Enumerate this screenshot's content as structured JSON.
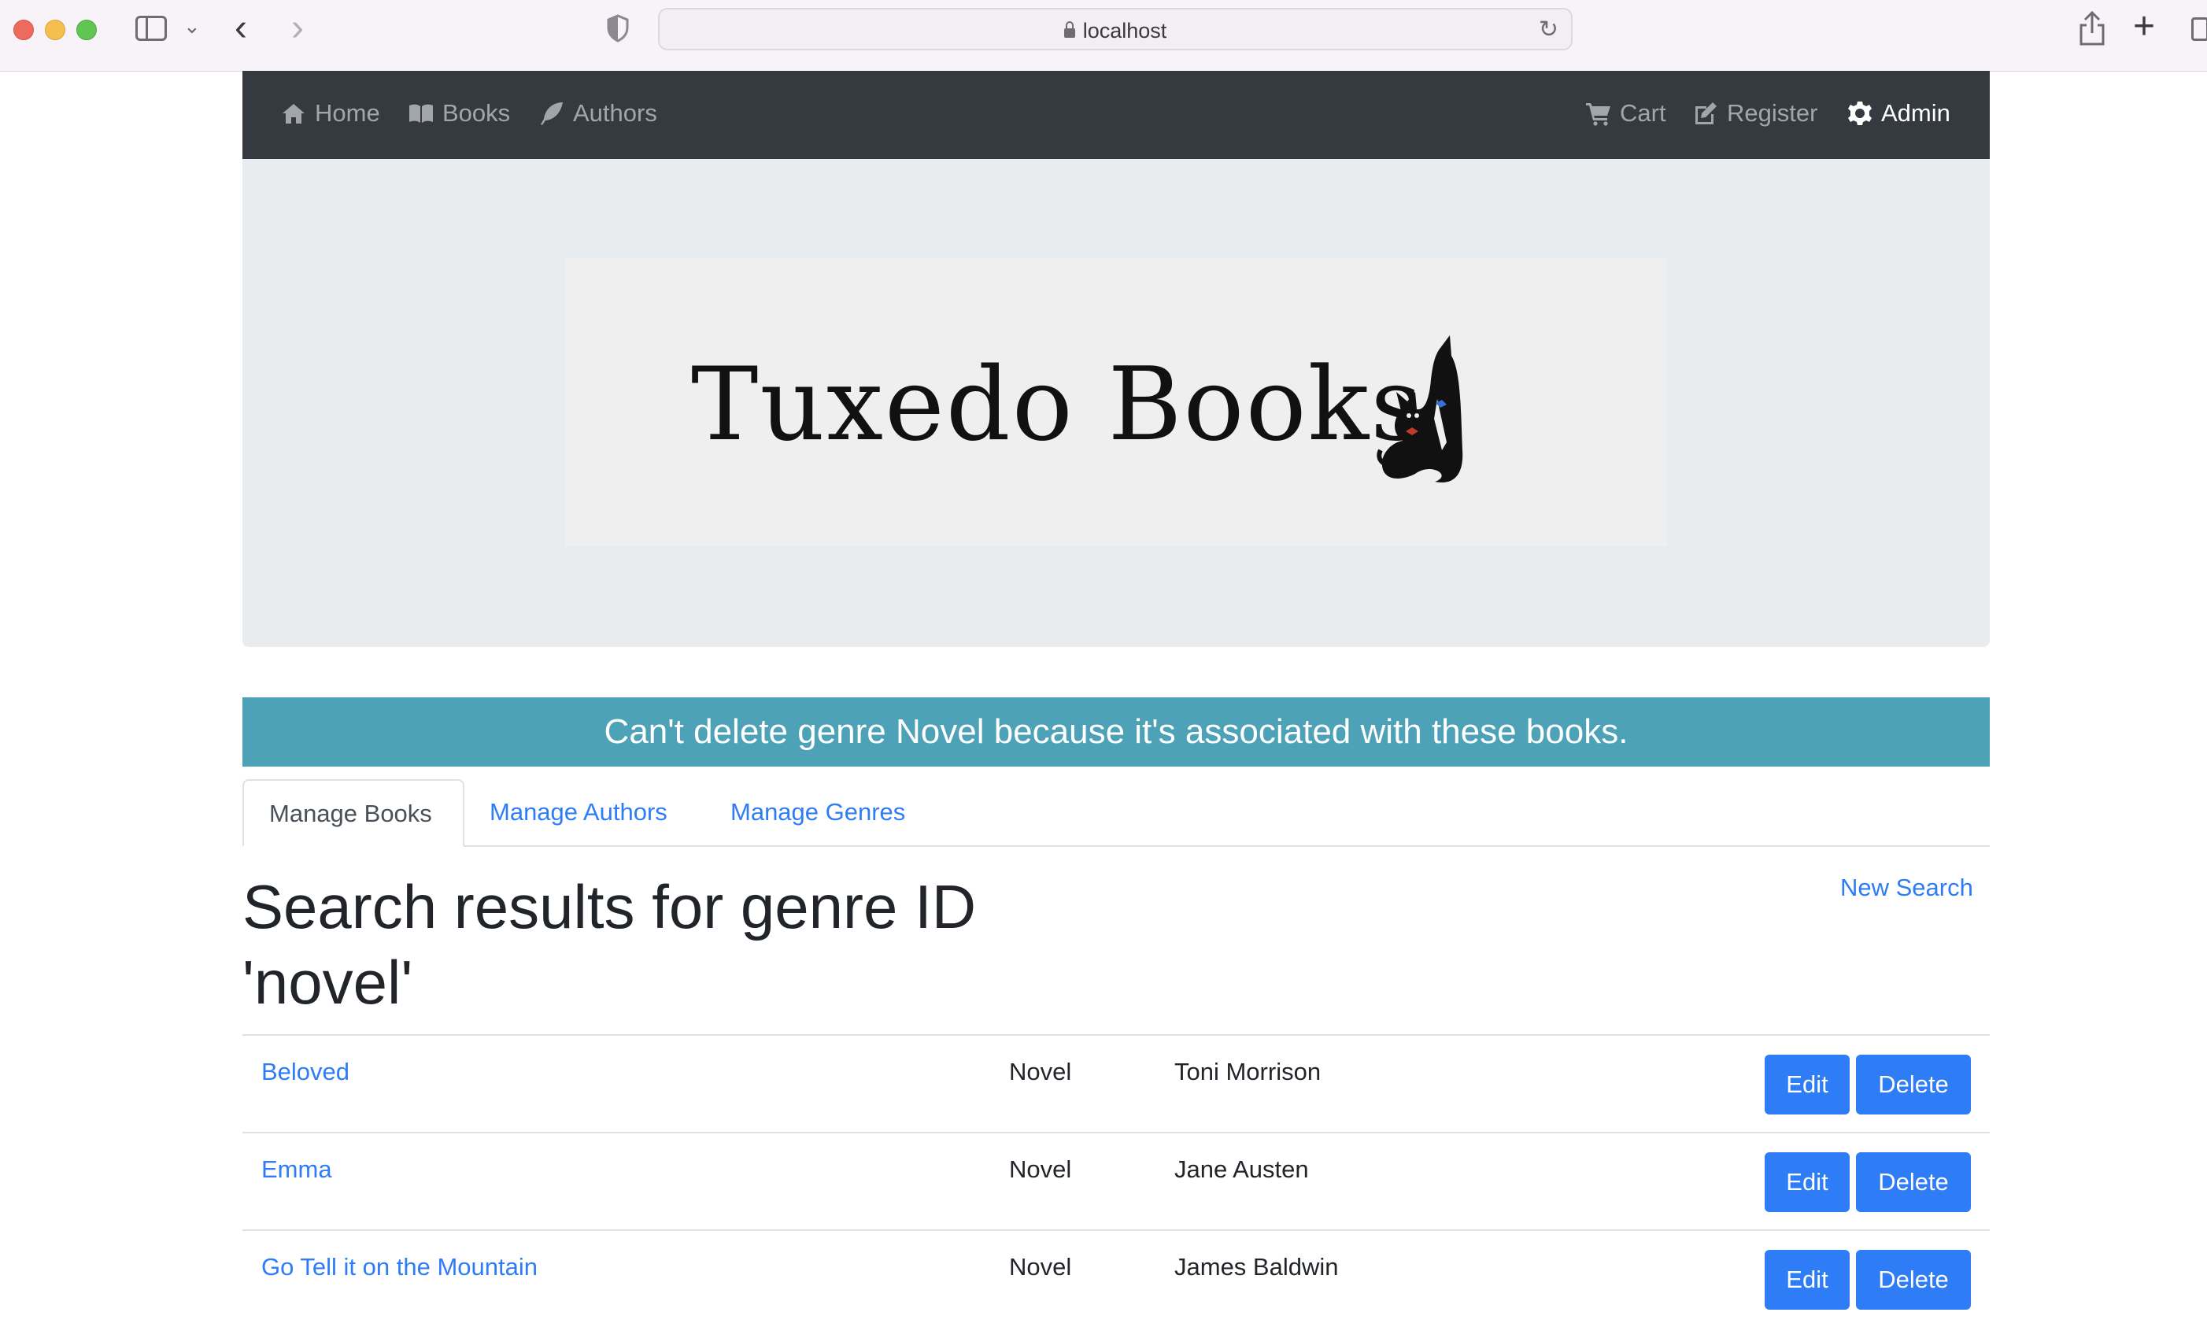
{
  "browser": {
    "url": "localhost"
  },
  "navbar": {
    "left": [
      {
        "label": "Home",
        "icon": "home-icon"
      },
      {
        "label": "Books",
        "icon": "book-icon"
      },
      {
        "label": "Authors",
        "icon": "feather-icon"
      }
    ],
    "right": [
      {
        "label": "Cart",
        "icon": "cart-icon"
      },
      {
        "label": "Register",
        "icon": "edit-icon"
      },
      {
        "label": "Admin",
        "icon": "gear-icon",
        "active": true
      }
    ]
  },
  "logo": {
    "text": "Tuxedo Books"
  },
  "alert": {
    "message": "Can't delete genre Novel because it's associated with these books."
  },
  "tabs": [
    {
      "label": "Manage Books",
      "active": true
    },
    {
      "label": "Manage Authors",
      "active": false
    },
    {
      "label": "Manage Genres",
      "active": false
    }
  ],
  "search": {
    "heading": "Search results for genre ID 'novel'",
    "new_search_label": "New Search"
  },
  "results": [
    {
      "title": "Beloved",
      "genre": "Novel",
      "author": "Toni Morrison"
    },
    {
      "title": "Emma",
      "genre": "Novel",
      "author": "Jane Austen"
    },
    {
      "title": "Go Tell it on the Mountain",
      "genre": "Novel",
      "author": "James Baldwin"
    }
  ],
  "actions": {
    "edit_label": "Edit",
    "delete_label": "Delete"
  },
  "colors": {
    "navbar": "#343a40",
    "alert": "#4da2b7",
    "link": "#2e7cf6",
    "button": "#2e7cf6"
  }
}
